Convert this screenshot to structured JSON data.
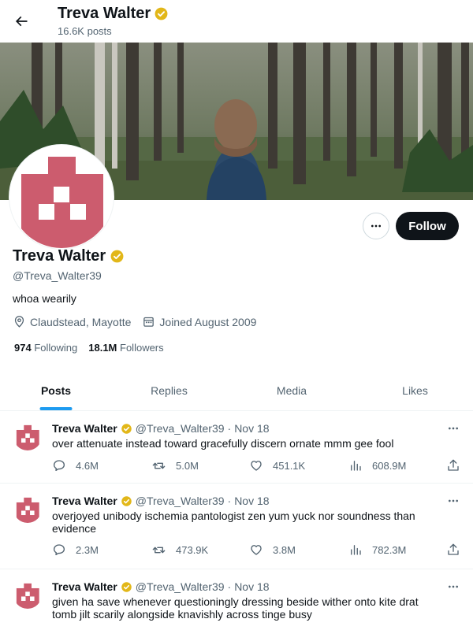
{
  "header": {
    "title": "Treva Walter",
    "posts_count": "16.6K posts"
  },
  "profile": {
    "name": "Treva Walter",
    "handle": "@Treva_Walter39",
    "bio": "whoa wearily",
    "location": "Claudstead, Mayotte",
    "joined": "Joined August 2009",
    "following_count": "974",
    "following_label": "Following",
    "followers_count": "18.1M",
    "followers_label": "Followers",
    "follow_label": "Follow",
    "verified": true
  },
  "colors": {
    "avatar_red": "#cc5c6e",
    "verified_gold": "#e2b719",
    "tab_accent": "#1d9bf0"
  },
  "tabs": [
    {
      "label": "Posts",
      "active": true
    },
    {
      "label": "Replies",
      "active": false
    },
    {
      "label": "Media",
      "active": false
    },
    {
      "label": "Likes",
      "active": false
    }
  ],
  "tweets": [
    {
      "name": "Treva Walter",
      "handle": "@Treva_Walter39",
      "separator": "·",
      "date": "Nov 18",
      "text": "over attenuate instead toward gracefully discern ornate mmm gee fool",
      "replies": "4.6M",
      "retweets": "5.0M",
      "likes": "451.1K",
      "views": "608.9M"
    },
    {
      "name": "Treva Walter",
      "handle": "@Treva_Walter39",
      "separator": "·",
      "date": "Nov 18",
      "text": "overjoyed unibody ischemia pantologist zen yum yuck nor soundness than evidence",
      "replies": "2.3M",
      "retweets": "473.9K",
      "likes": "3.8M",
      "views": "782.3M"
    },
    {
      "name": "Treva Walter",
      "handle": "@Treva_Walter39",
      "separator": "·",
      "date": "Nov 18",
      "text": "given ha save whenever questioningly dressing beside wither onto kite drat tomb jilt scarily alongside knavishly across tinge busy",
      "replies": "",
      "retweets": "",
      "likes": "",
      "views": ""
    }
  ]
}
